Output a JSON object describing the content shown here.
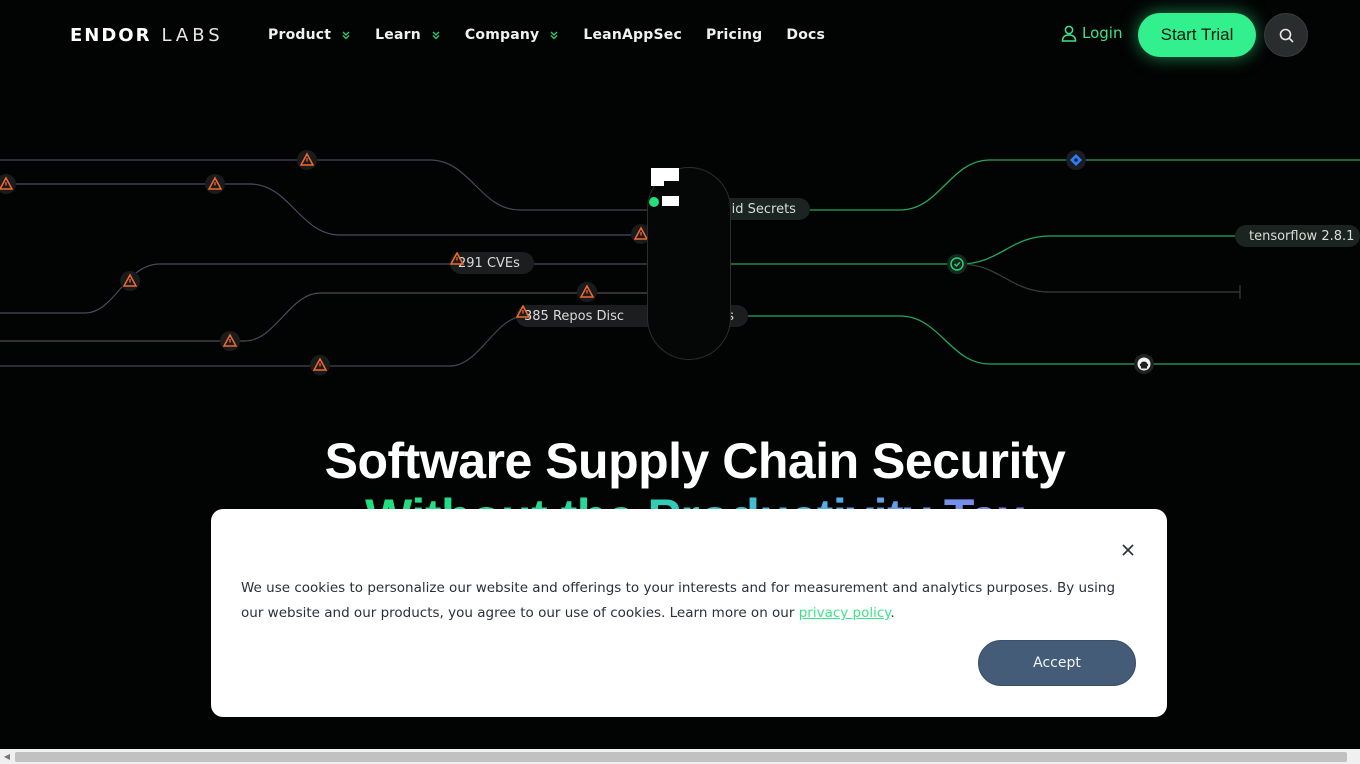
{
  "nav": {
    "logo": {
      "word1": "ENDOR",
      "word2": "LABS"
    },
    "items": [
      {
        "label": "Product",
        "has_dropdown": true
      },
      {
        "label": "Learn",
        "has_dropdown": true
      },
      {
        "label": "Company",
        "has_dropdown": true
      },
      {
        "label": "LeanAppSec",
        "has_dropdown": false
      },
      {
        "label": "Pricing",
        "has_dropdown": false
      },
      {
        "label": "Docs",
        "has_dropdown": false
      }
    ],
    "login_label": "Login",
    "start_trial_label": "Start Trial",
    "search_icon": "search-icon"
  },
  "graphic": {
    "pills": {
      "secrets": "lid Secrets",
      "cves": "291 CVEs",
      "repos": "385 Repos Disc",
      "repos_tail": "s",
      "tensorflow": "tensorflow 2.8.1"
    },
    "icons": [
      "warning-icon",
      "jira-icon",
      "check-circle-icon",
      "github-icon",
      "endor-logo-icon"
    ],
    "colors": {
      "warning": "#f26a2e",
      "green": "#2fcf7a",
      "jira": "#2d7ff9"
    }
  },
  "hero": {
    "headline": "Software Supply Chain Security",
    "subline": "Without the Productivity Tax"
  },
  "cookie": {
    "text_before": "We use cookies to personalize our website and offerings to your interests and for measurement and analytics purposes. By using our website and our products, you agree to our use of cookies. Learn more on our ",
    "link_label": "privacy policy",
    "text_after": ".",
    "accept_label": "Accept"
  },
  "colors": {
    "accent": "#33f08f",
    "background": "#020303",
    "accept_button": "#445c78"
  }
}
